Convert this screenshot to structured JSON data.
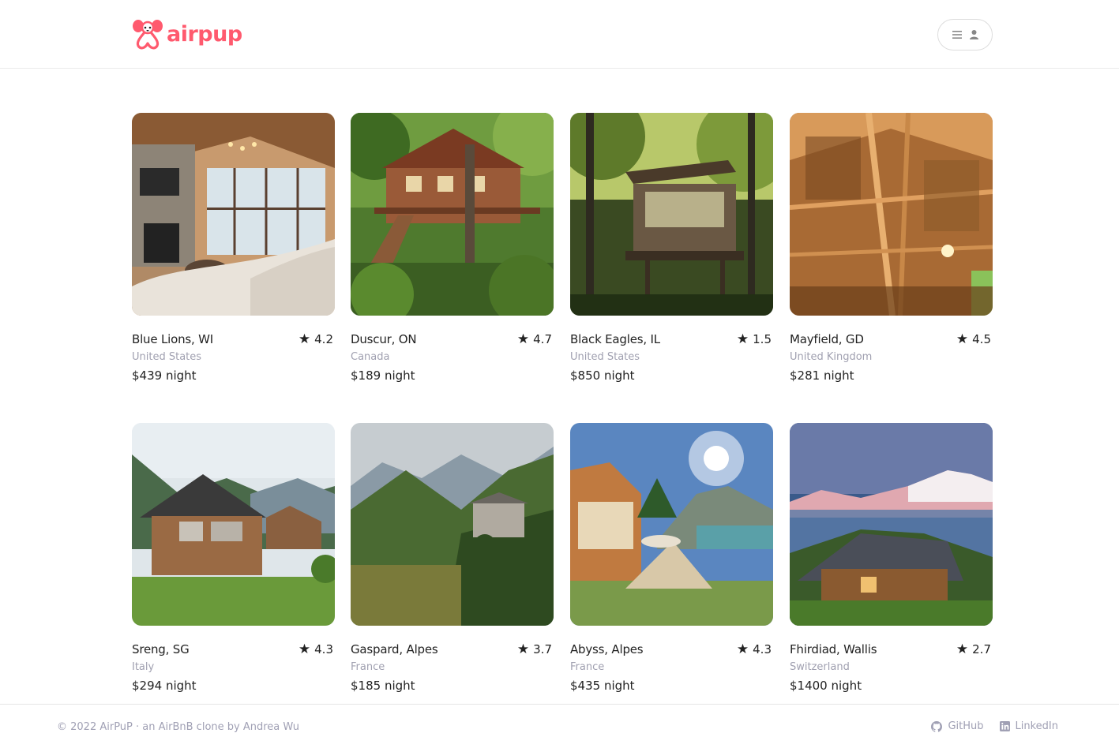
{
  "brand": {
    "name": "airpup",
    "color": "#ff5a6e"
  },
  "header": {
    "menu_icon": "hamburger-icon",
    "user_icon": "user-icon"
  },
  "listings": [
    {
      "location": "Blue Lions, WI",
      "country": "United States",
      "rating": "4.2",
      "price": "$439 night"
    },
    {
      "location": "Duscur, ON",
      "country": "Canada",
      "rating": "4.7",
      "price": "$189 night"
    },
    {
      "location": "Black Eagles, IL",
      "country": "United States",
      "rating": "1.5",
      "price": "$850 night"
    },
    {
      "location": "Mayfield, GD",
      "country": "United Kingdom",
      "rating": "4.5",
      "price": "$281 night"
    },
    {
      "location": "Sreng, SG",
      "country": "Italy",
      "rating": "4.3",
      "price": "$294 night"
    },
    {
      "location": "Gaspard, Alpes",
      "country": "France",
      "rating": "3.7",
      "price": "$185 night"
    },
    {
      "location": "Abyss, Alpes",
      "country": "France",
      "rating": "4.3",
      "price": "$435 night"
    },
    {
      "location": "Fhirdiad, Wallis",
      "country": "Switzerland",
      "rating": "2.7",
      "price": "$1400 night"
    }
  ],
  "star_glyph": "★",
  "footer": {
    "copyright": "© 2022 AirPuP  ·  an AirBnB clone by Andrea Wu",
    "links": [
      {
        "label": "GitHub",
        "icon": "github-icon"
      },
      {
        "label": "LinkedIn",
        "icon": "linkedin-icon"
      }
    ]
  }
}
